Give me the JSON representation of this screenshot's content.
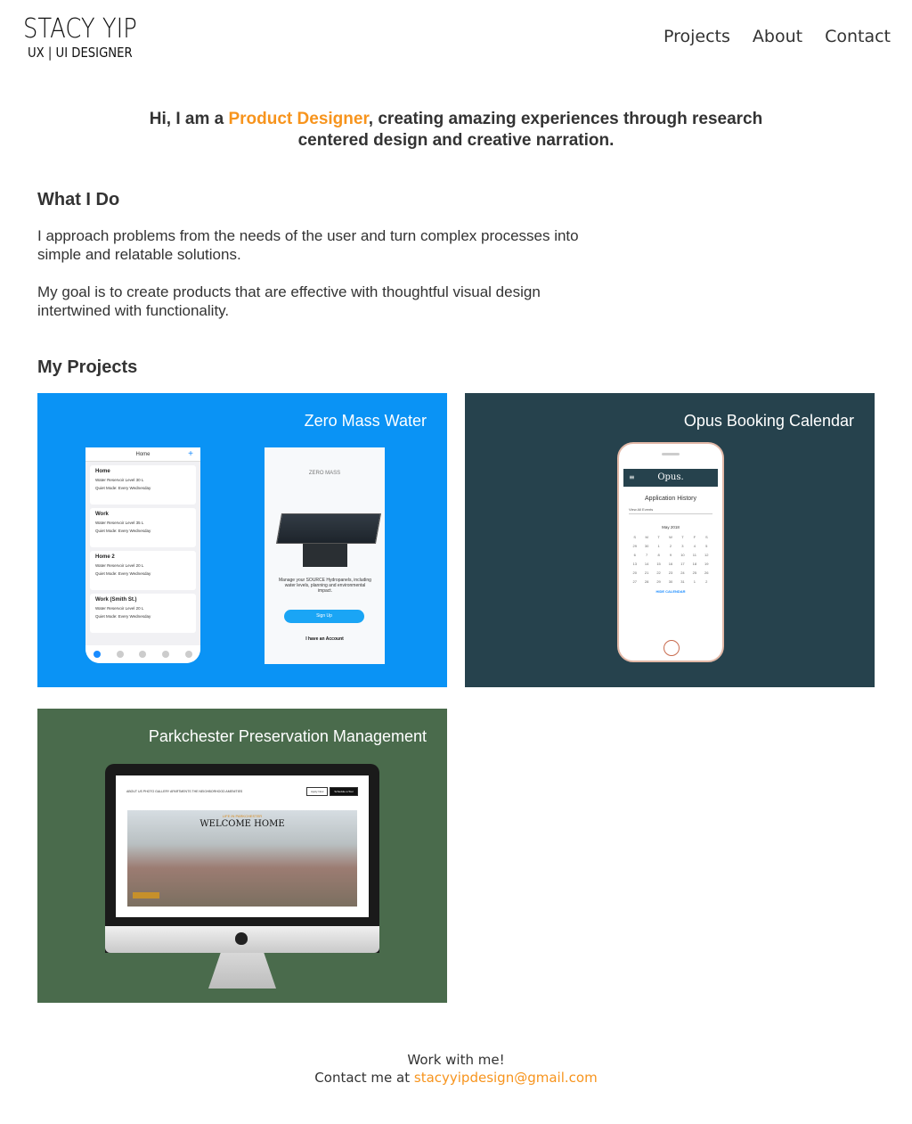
{
  "header": {
    "logo_name": "STACY YIP",
    "logo_sub": "UX | UI DESIGNER",
    "nav": [
      "Projects",
      "About",
      "Contact"
    ]
  },
  "intro": {
    "prefix": "Hi, I am a ",
    "highlight": "Product Designer",
    "line1_rest": ", creating amazing experiences through research",
    "line2": "centered design and creative narration."
  },
  "what_i_do": {
    "title": "What I Do",
    "p1_line1": "I approach problems from the needs of the user and turn complex processes into",
    "p1_line2": "simple and relatable solutions.",
    "p2_line1": "My goal is to create products that are effective with thoughtful visual design",
    "p2_line2": "intertwined with functionality."
  },
  "projects": {
    "title": "My Projects",
    "items": [
      {
        "title": "Zero Mass Water",
        "bg": "#0a93f5"
      },
      {
        "title": "Opus Booking Calendar",
        "bg": "#26424d"
      },
      {
        "title": "Parkchester Preservation Management",
        "bg": "#4a6b4c"
      }
    ]
  },
  "zmw_mock": {
    "bar_title": "Home",
    "tiles": [
      {
        "name": "Home",
        "level": "Water Reservoir Level     30 L",
        "mode": "Quiet Mode: Every Wednesday"
      },
      {
        "name": "Work",
        "level": "Water Reservoir Level     35 L",
        "mode": "Quiet Mode: Every Wednesday"
      },
      {
        "name": "Home 2",
        "level": "Water Reservoir Level     20 L",
        "mode": "Quiet Mode: Every Wednesday"
      },
      {
        "name": "Work (Smith St.)",
        "level": "Water Reservoir Level     20 L",
        "mode": "Quiet Mode: Every Wednesday"
      }
    ],
    "brand": "ZERO MASS",
    "message": "Manage your SOURCE Hydropanels, including water levels, planning and environmental impact.",
    "signup": "Sign Up",
    "account": "I have an Account"
  },
  "opus_mock": {
    "brand": "Opus.",
    "heading": "Application History",
    "select": "View All Events",
    "month": "May 2018",
    "days": [
      "S",
      "M",
      "T",
      "W",
      "T",
      "F",
      "S",
      "29",
      "30",
      "1",
      "2",
      "3",
      "4",
      "5",
      "6",
      "7",
      "8",
      "9",
      "10",
      "11",
      "12",
      "13",
      "14",
      "15",
      "16",
      "17",
      "18",
      "19",
      "20",
      "21",
      "22",
      "23",
      "24",
      "25",
      "26",
      "27",
      "28",
      "29",
      "30",
      "31",
      "1",
      "2"
    ],
    "hide": "HIDE CALENDAR"
  },
  "park_mock": {
    "sub": "LIFE IN PARKCHESTER",
    "headline": "WELCOME HOME",
    "nav": "ABOUT US   PHOTO GALLERY   APARTMENTS   THE NEIGHBORHOOD   AMENITIES",
    "apply": "Apply Now",
    "schedule": "Schedule a Tour"
  },
  "footer": {
    "line1": "Work with me!",
    "line2_prefix": "Contact me at ",
    "email": "stacyyipdesign@gmail.com"
  }
}
